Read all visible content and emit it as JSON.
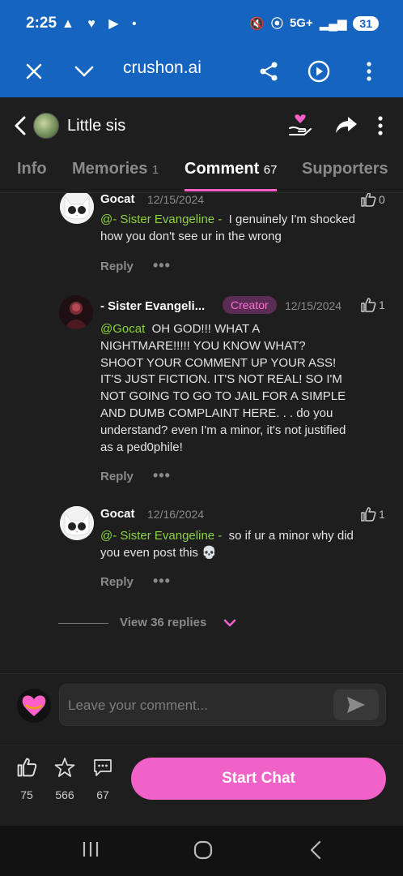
{
  "status": {
    "time": "2:25",
    "network": "5G+",
    "battery": "31",
    "left_icons": "▲ ♥ ▶ •"
  },
  "browser": {
    "url": "crushon.ai"
  },
  "header": {
    "title": "Little sis"
  },
  "tabs": [
    {
      "label": "Info",
      "count": ""
    },
    {
      "label": "Memories",
      "count": "1"
    },
    {
      "label": "Comment",
      "count": "67"
    },
    {
      "label": "Supporters",
      "count": ""
    }
  ],
  "comments": [
    {
      "author": "Gocat",
      "date": "12/15/2024",
      "likes": "0",
      "mention": "@- Sister Evangeline -",
      "text": "I genuinely I'm shocked how you don't see ur in the wrong",
      "reply_label": "Reply",
      "more": "•••"
    },
    {
      "author": "- Sister Evangeli...",
      "badge": "Creator",
      "date": "12/15/2024",
      "likes": "1",
      "mention": "@Gocat",
      "text": "OH GOD!!! WHAT A NIGHTMARE!!!!! YOU KNOW WHAT? SHOOT YOUR COMMENT UP YOUR ASS! IT'S JUST FICTION. IT'S NOT REAL! SO I'M NOT GOING TO GO TO JAIL FOR A SIMPLE AND DUMB COMPLAINT HERE. . . do you understand? even I'm a minor, it's not justified as a ped0phile!",
      "reply_label": "Reply",
      "more": "•••"
    },
    {
      "author": "Gocat",
      "date": "12/16/2024",
      "likes": "1",
      "mention": "@- Sister Evangeline -",
      "text": "so if ur a minor why did you even post this 💀",
      "reply_label": "Reply",
      "more": "•••"
    }
  ],
  "view_replies": "View 36 replies",
  "composer": {
    "placeholder": "Leave your comment..."
  },
  "stats": {
    "likes": "75",
    "favorites": "566",
    "comments": "67"
  },
  "start_chat": "Start Chat",
  "colors": {
    "status_bar": "#1565c0",
    "accent_pink": "#f062c8",
    "mention_green": "#8bd43f",
    "background": "#1e1e1e"
  }
}
